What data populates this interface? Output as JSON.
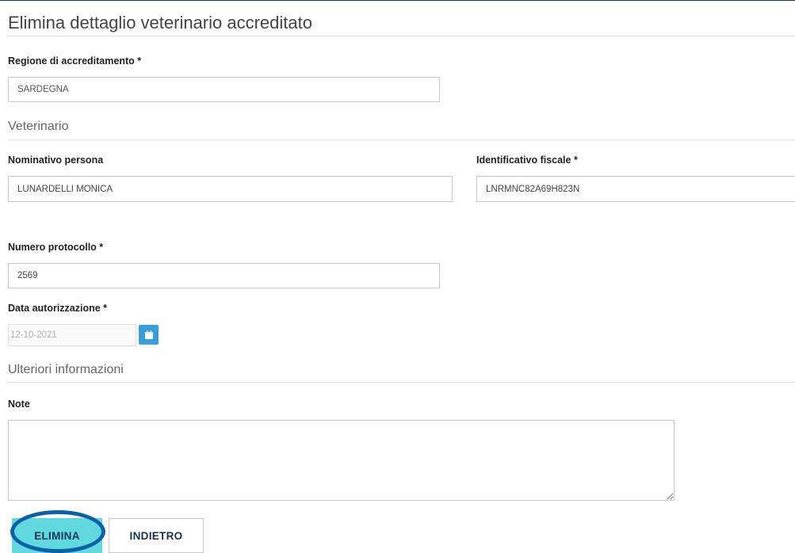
{
  "page": {
    "title": "Elimina dettaglio veterinario accreditato"
  },
  "regione": {
    "label": "Regione di accreditamento *",
    "value": "SARDEGNA"
  },
  "veterinario": {
    "section_title": "Veterinario",
    "nominativo_label": "Nominativo persona",
    "nominativo_value": "LUNARDELLI MONICA",
    "fiscale_label": "Identificativo fiscale *",
    "fiscale_value": "LNRMNC82A69H823N"
  },
  "protocollo": {
    "label": "Numero protocollo *",
    "value": "2569"
  },
  "data_autorizzazione": {
    "label": "Data autorizzazione *",
    "value": "12-10-2021",
    "icon": "calendar-icon"
  },
  "ulteriori": {
    "section_title": "Ulteriori informazioni",
    "note_label": "Note",
    "note_value": ""
  },
  "actions": {
    "delete_label": "ELIMINA",
    "back_label": "INDIETRO"
  },
  "colors": {
    "accent": "#5fd8e0",
    "navy": "#17324d",
    "calendar": "#3b9ed8",
    "highlight": "#0d5fa6"
  }
}
